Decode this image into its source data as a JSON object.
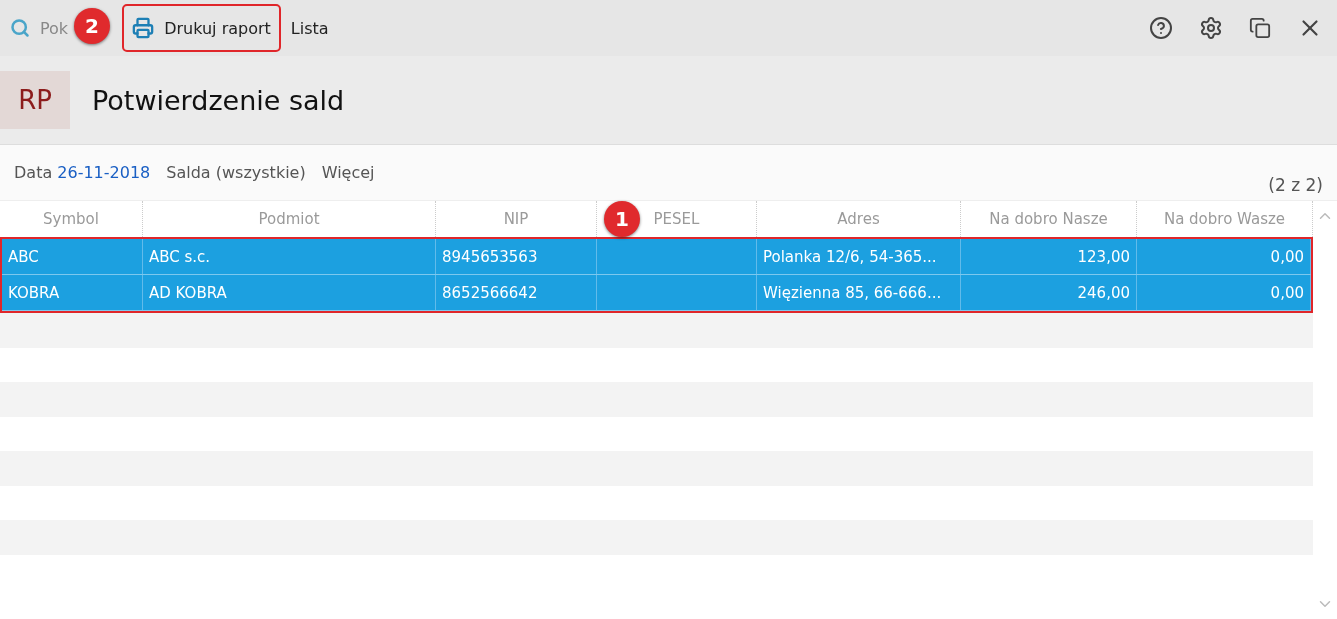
{
  "toolbar": {
    "search_label": "Pok",
    "print_button": {
      "label": "Drukuj raport",
      "highlighted": true
    },
    "list_button": "Lista"
  },
  "header": {
    "badge": "RP",
    "title": "Potwierdzenie sald"
  },
  "filters": {
    "date_label": "Data",
    "date_value": "26-11-2018",
    "balances": "Salda (wszystkie)",
    "more": "Więcej",
    "count": "(2 z 2)"
  },
  "table": {
    "columns": [
      "Symbol",
      "Podmiot",
      "NIP",
      "PESEL",
      "Adres",
      "Na dobro Nasze",
      "Na dobro Wasze"
    ],
    "rows": [
      {
        "selected": true,
        "cells": [
          "ABC",
          "ABC s.c.",
          "8945653563",
          "",
          "Polanka  12/6, 54-365...",
          "123,00",
          "0,00"
        ]
      },
      {
        "selected": true,
        "cells": [
          "KOBRA",
          "AD KOBRA",
          "8652566642",
          "",
          "Więzienna  85, 66-666...",
          "246,00",
          "0,00"
        ]
      }
    ],
    "rows_highlighted": true
  },
  "annotations": [
    {
      "label": "1"
    },
    {
      "label": "2"
    }
  ]
}
